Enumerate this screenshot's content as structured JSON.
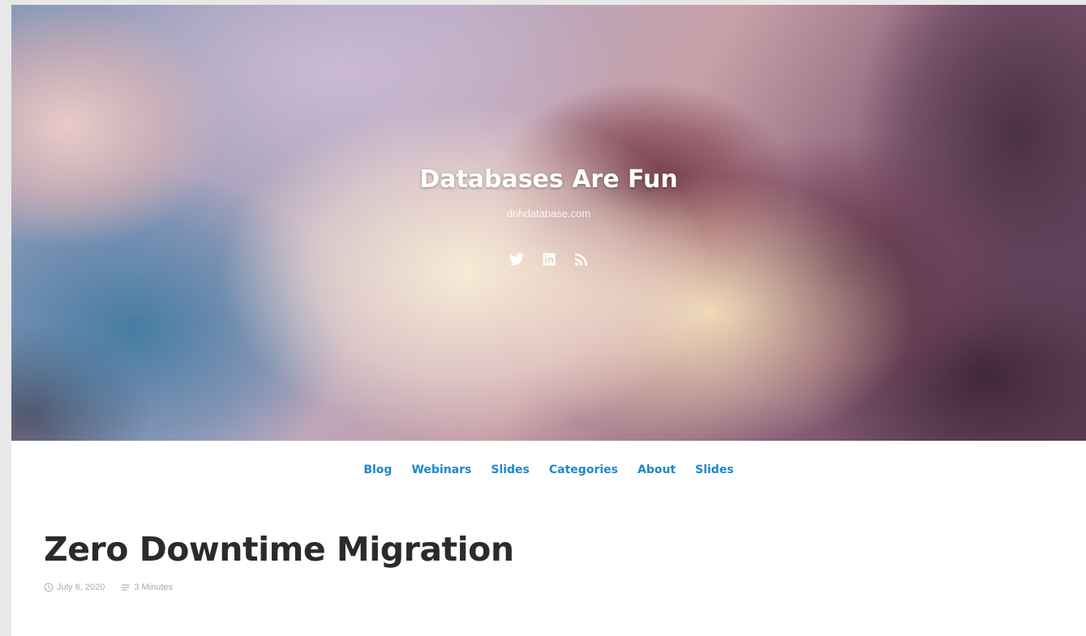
{
  "site": {
    "title": "Databases Are Fun",
    "subtitle": "dohdatabase.com"
  },
  "social": [
    {
      "icon": "twitter-icon"
    },
    {
      "icon": "linkedin-icon"
    },
    {
      "icon": "rss-icon"
    }
  ],
  "nav": {
    "items": [
      {
        "label": "Blog"
      },
      {
        "label": "Webinars"
      },
      {
        "label": "Slides"
      },
      {
        "label": "Categories"
      },
      {
        "label": "About"
      },
      {
        "label": "Slides"
      }
    ]
  },
  "post": {
    "title": "Zero Downtime Migration",
    "date": "July 6, 2020",
    "reading_time": "3 Minutes"
  },
  "colors": {
    "link": "#1e88c7",
    "title": "#2b2b2b",
    "meta": "#aaaaaa"
  }
}
